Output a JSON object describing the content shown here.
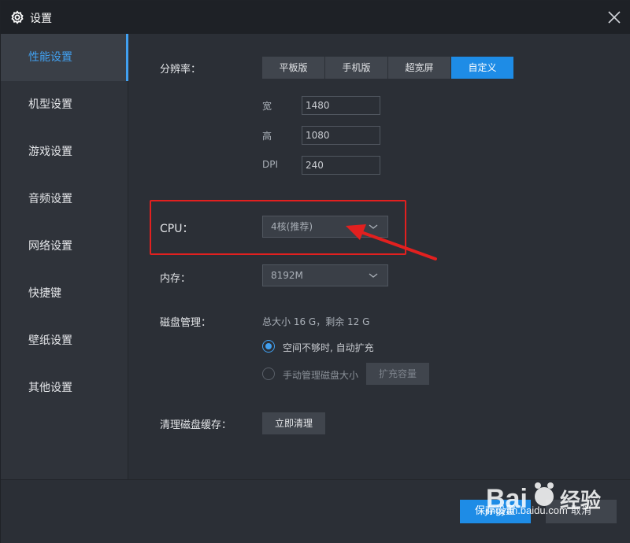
{
  "window": {
    "title": "设置"
  },
  "sidebar": {
    "items": [
      {
        "label": "性能设置",
        "active": true
      },
      {
        "label": "机型设置"
      },
      {
        "label": "游戏设置"
      },
      {
        "label": "音频设置"
      },
      {
        "label": "网络设置"
      },
      {
        "label": "快捷键"
      },
      {
        "label": "壁纸设置"
      },
      {
        "label": "其他设置"
      }
    ]
  },
  "resolution": {
    "label": "分辨率：",
    "options": [
      "平板版",
      "手机版",
      "超宽屏",
      "自定义"
    ],
    "selected": "自定义",
    "width_label": "宽",
    "width_value": "1480",
    "height_label": "高",
    "height_value": "1080",
    "dpi_label": "DPI",
    "dpi_value": "240"
  },
  "cpu": {
    "label": "CPU：",
    "value": "4核(推荐)"
  },
  "memory": {
    "label": "内存：",
    "value": "8192M"
  },
  "disk": {
    "label": "磁盘管理：",
    "summary": "总大小 16 G，剩余 12 G",
    "option_auto": "空间不够时, 自动扩充",
    "option_manual": "手动管理磁盘大小",
    "expand_button": "扩充容量",
    "selected": "auto"
  },
  "cache": {
    "label": "清理磁盘缓存：",
    "button": "立即清理"
  },
  "footer": {
    "save_button": "保存设置",
    "cancel_button": "取消"
  },
  "watermark": {
    "text": "jingyan.baidu.com",
    "logo_text": "Bai经验"
  },
  "colors": {
    "accent": "#1e8ce6",
    "annotation": "#e2201f"
  },
  "icons": {
    "title": "gear-icon",
    "close": "close-icon",
    "dropdown": "chevron-down-icon"
  }
}
